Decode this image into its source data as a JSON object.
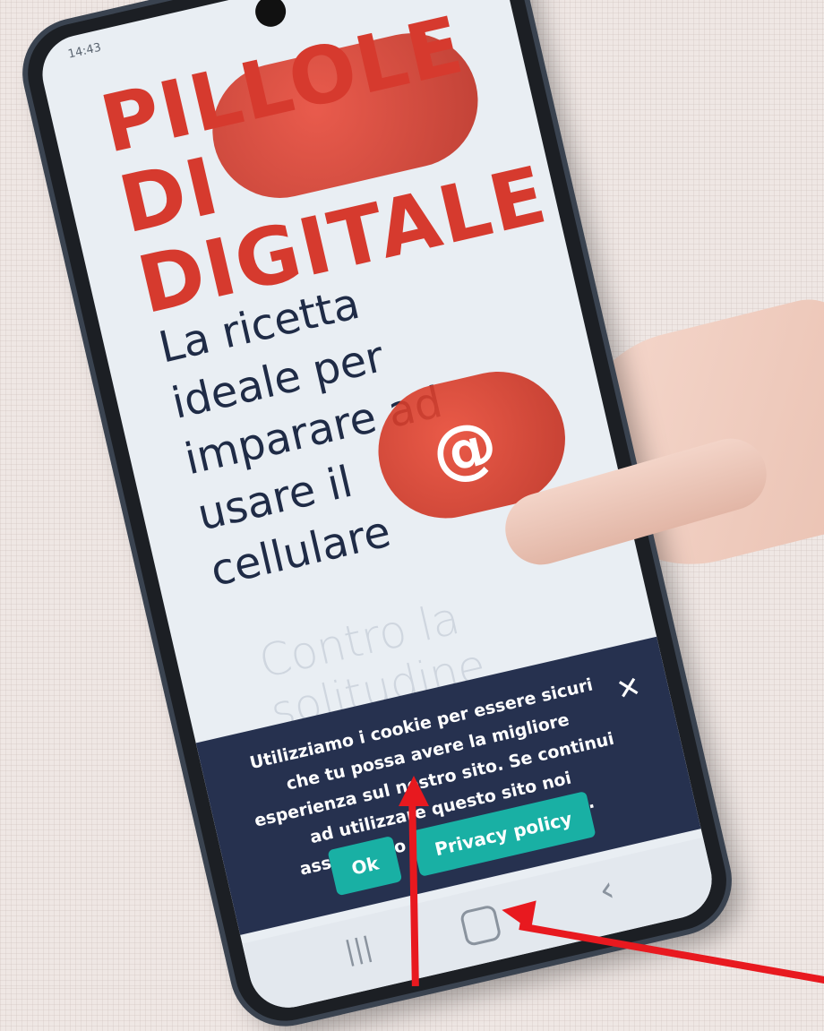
{
  "status_bar": {
    "time": "14:43",
    "icons": "◔ ▮"
  },
  "site": {
    "hero_title": "PILLOLE\nDI\nDIGITALE",
    "hero_subtitle": "La ricetta\nideale per\nimparare ad\nusare il\ncellulare",
    "hero_image_icon": "@",
    "section_heading": "Contro la solitudine"
  },
  "cookie_banner": {
    "message": "Utilizziamo i cookie per essere sicuri che tu possa avere la migliore esperienza sul nostro sito. Se continui ad utilizzare questo sito noi assumiamo che tu ne sia felice.",
    "ok_label": "Ok",
    "privacy_label": "Privacy policy",
    "close_glyph": "✕"
  },
  "nav_bar": {
    "recent_glyph": "|||",
    "back_glyph": "‹"
  },
  "colors": {
    "accent": "#19b0a4",
    "banner": "#26314f",
    "brand_red": "#d63a2e",
    "annotation_arrow": "#e8191f"
  }
}
